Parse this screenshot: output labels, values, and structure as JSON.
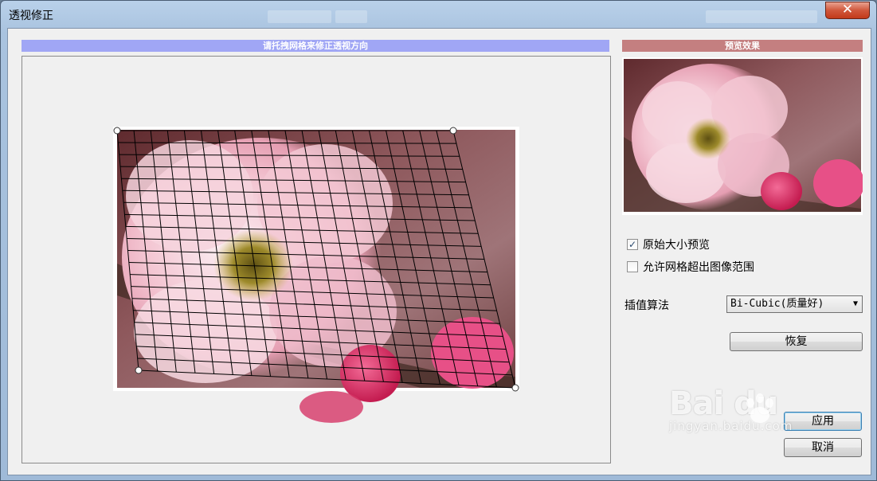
{
  "window": {
    "title": "透视修正",
    "close_glyph": "✕"
  },
  "left_panel": {
    "header": "请托拽网格来修正透视方向"
  },
  "right_panel": {
    "header": "预览效果"
  },
  "options": {
    "original_size_preview": {
      "label": "原始大小预览",
      "checked": true
    },
    "allow_grid_outside": {
      "label": "允许网格超出图像范围",
      "checked": false
    }
  },
  "interpolation": {
    "label": "插值算法",
    "selected": "Bi-Cubic(质量好)"
  },
  "buttons": {
    "restore": "恢复",
    "apply": "应用",
    "cancel": "取消"
  },
  "watermark": {
    "logo": "Bai du",
    "url": "jingyan.baidu.com"
  },
  "colors": {
    "left_header": "#a0a6f5",
    "right_header": "#c47f80",
    "close": "#c2391a"
  }
}
